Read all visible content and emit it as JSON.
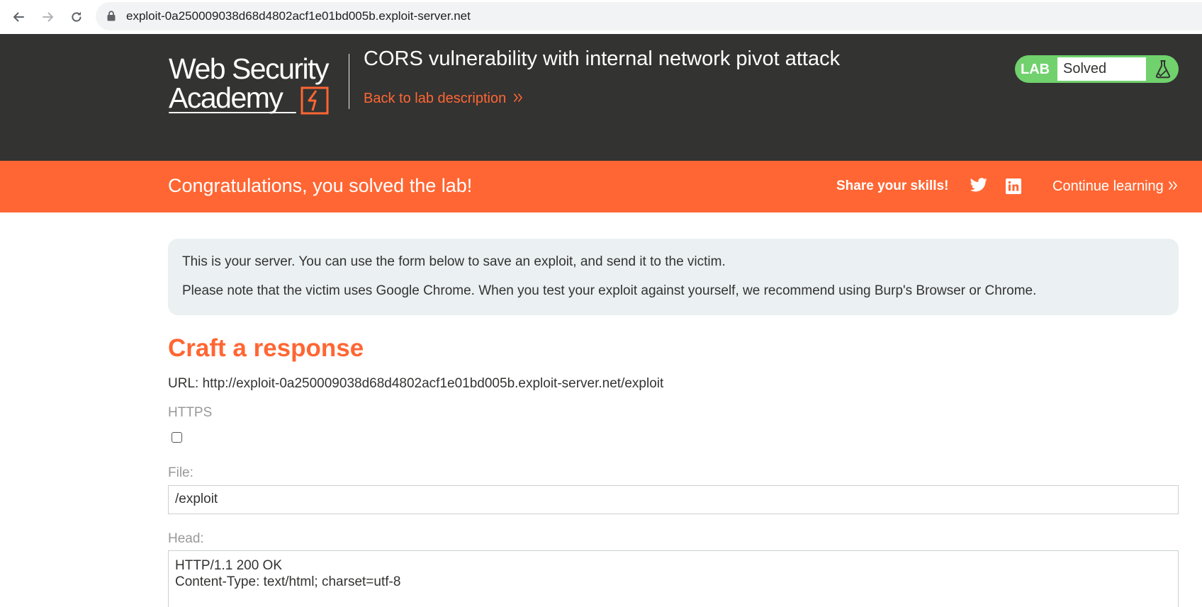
{
  "browser": {
    "url": "exploit-0a250009038d68d4802acf1e01bd005b.exploit-server.net",
    "icons": [
      "back-arrow-icon",
      "forward-arrow-icon",
      "reload-icon",
      "lock-icon"
    ]
  },
  "header": {
    "logo_line1": "Web Security",
    "logo_line2": "Academy",
    "lab_title": "CORS vulnerability with internal network pivot attack",
    "back_link": "Back to lab description",
    "lab_badge": "LAB",
    "lab_status": "Solved",
    "colors": {
      "background": "#333332",
      "accent": "#ff6633",
      "solved": "#70d16d"
    }
  },
  "banner": {
    "message": "Congratulations, you solved the lab!",
    "share_label": "Share your skills!",
    "continue_label": "Continue learning",
    "icons": [
      "twitter-icon",
      "linkedin-icon"
    ]
  },
  "info": {
    "line1": "This is your server. You can use the form below to save an exploit, and send it to the victim.",
    "line2": "Please note that the victim uses Google Chrome. When you test your exploit against yourself, we recommend using Burp's Browser or Chrome."
  },
  "form": {
    "title": "Craft a response",
    "url_line": "URL: http://exploit-0a250009038d68d4802acf1e01bd005b.exploit-server.net/exploit",
    "https_label": "HTTPS",
    "https_checked": false,
    "file_label": "File:",
    "file_value": "/exploit",
    "head_label": "Head:",
    "head_lines": [
      "HTTP/1.1 200 OK",
      "Content-Type: text/html; charset=utf-8"
    ]
  }
}
